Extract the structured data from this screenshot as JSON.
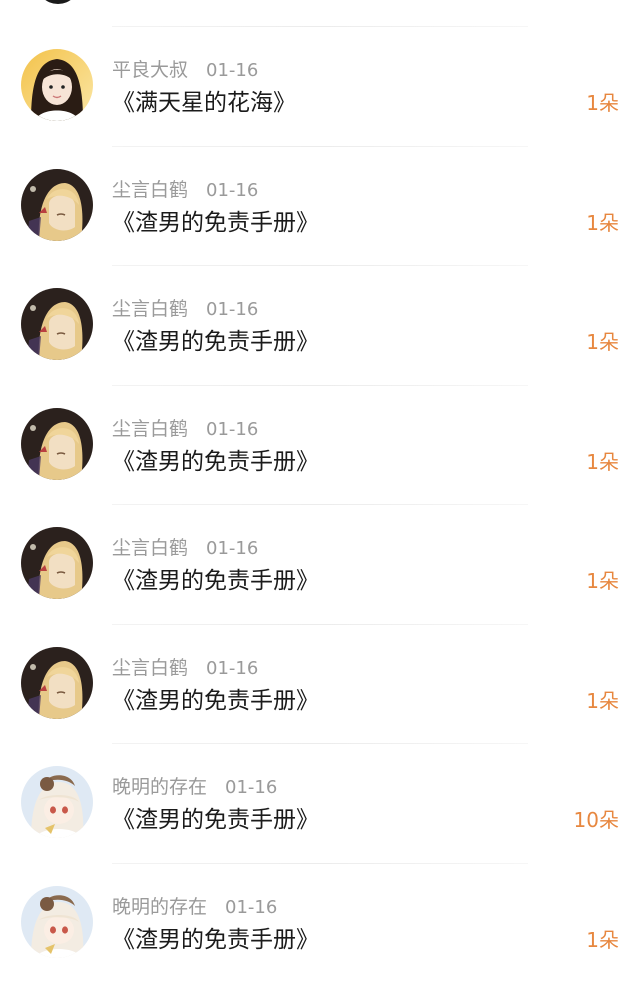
{
  "rows": [
    {
      "user": "平良大叔",
      "date": "01-16",
      "title": "《满天星的花海》",
      "count": "1朵",
      "avatar": "avatar-girl-photo"
    },
    {
      "user": "尘言白鹤",
      "date": "01-16",
      "title": "《渣男的免责手册》",
      "count": "1朵",
      "avatar": "avatar-anime-dark"
    },
    {
      "user": "尘言白鹤",
      "date": "01-16",
      "title": "《渣男的免责手册》",
      "count": "1朵",
      "avatar": "avatar-anime-dark"
    },
    {
      "user": "尘言白鹤",
      "date": "01-16",
      "title": "《渣男的免责手册》",
      "count": "1朵",
      "avatar": "avatar-anime-dark"
    },
    {
      "user": "尘言白鹤",
      "date": "01-16",
      "title": "《渣男的免责手册》",
      "count": "1朵",
      "avatar": "avatar-anime-dark"
    },
    {
      "user": "尘言白鹤",
      "date": "01-16",
      "title": "《渣男的免责手册》",
      "count": "1朵",
      "avatar": "avatar-anime-dark"
    },
    {
      "user": "晚明的存在",
      "date": "01-16",
      "title": "《渣男的免责手册》",
      "count": "10朵",
      "avatar": "avatar-anime-light"
    },
    {
      "user": "晚明的存在",
      "date": "01-16",
      "title": "《渣男的免责手册》",
      "count": "1朵",
      "avatar": "avatar-anime-light"
    }
  ],
  "colors": {
    "count": "#e7873f",
    "username": "#9a9a9a",
    "title": "#1b1b1b"
  }
}
